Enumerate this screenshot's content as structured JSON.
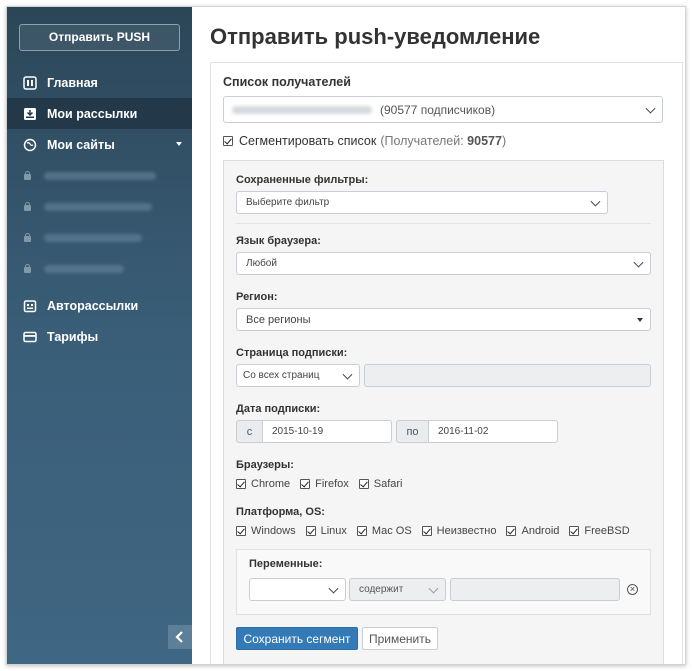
{
  "sidebar": {
    "push_button": "Отправить PUSH",
    "items": [
      {
        "label": "Главная",
        "icon": "dashboard-icon"
      },
      {
        "label": "Мои рассылки",
        "icon": "inbox-icon",
        "active": true
      },
      {
        "label": "Мои сайты",
        "icon": "globe-icon"
      }
    ],
    "sites_count": 4,
    "bottom_items": [
      {
        "label": "Авторассылки",
        "icon": "calendar-icon"
      },
      {
        "label": "Тарифы",
        "icon": "card-icon"
      }
    ],
    "collapse_icon": "chevron-left-icon"
  },
  "main": {
    "title": "Отправить push-уведомление",
    "recipients_label": "Список получателей",
    "recipients_select_suffix": "(90577 подписчиков)",
    "segment_checkbox_label": "Сегментировать список",
    "segment_count_prefix": "(Получателей: ",
    "segment_count": "90577",
    "segment_count_suffix": ")",
    "filters": {
      "saved_filters_label": "Сохраненные фильтры:",
      "saved_filters_value": "Выберите фильтр",
      "browser_lang_label": "Язык браузера:",
      "browser_lang_value": "Любой",
      "region_label": "Регион:",
      "region_value": "Все регионы",
      "subscribe_page_label": "Страница подписки:",
      "subscribe_page_value": "Со всех страниц",
      "subscribe_page_input": "",
      "date_label": "Дата подписки:",
      "date_from_prefix": "с",
      "date_from": "2015-10-19",
      "date_to_prefix": "по",
      "date_to": "2016-11-02",
      "browsers_label": "Браузеры:",
      "browsers": [
        "Chrome",
        "Firefox",
        "Safari"
      ],
      "platforms_label": "Платформа, OS:",
      "platforms": [
        "Windows",
        "Linux",
        "Mac OS",
        "Неизвестно",
        "Android",
        "FreeBSD"
      ],
      "variables_label": "Переменные:",
      "variable_name": "",
      "variable_operator": "содержит",
      "variable_value": "",
      "save_button": "Сохранить сегмент",
      "apply_button": "Применить"
    }
  },
  "colors": {
    "sidebar_top": "#2c4658",
    "sidebar_bottom": "#3f6682",
    "active_item": "#23394a",
    "primary": "#337ab7"
  }
}
